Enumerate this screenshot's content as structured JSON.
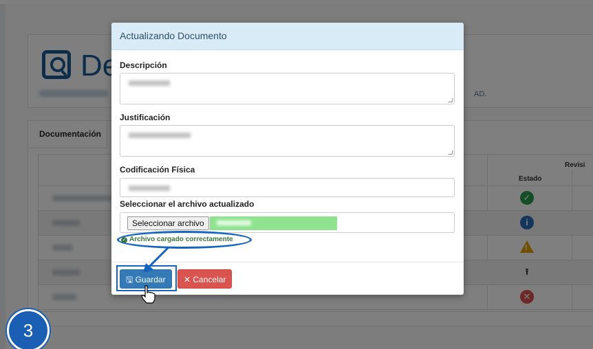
{
  "background": {
    "title": "De",
    "subtitle_tail": "AD.",
    "docs_tab": "Documentación",
    "table": {
      "group_header": "Revisi",
      "status_header": "Estado",
      "rows": [
        {
          "status": "check"
        },
        {
          "status": "info"
        },
        {
          "status": "warning"
        },
        {
          "status": "upload"
        },
        {
          "status": "error"
        }
      ]
    }
  },
  "modal": {
    "title": "Actualizando Documento",
    "fields": {
      "description_label": "Descripción",
      "justification_label": "Justificación",
      "physical_code_label": "Codificación Física",
      "file_label": "Seleccionar el archivo actualizado"
    },
    "file_button": "Seleccionar archivo",
    "success_message": "Archivo cargado correctamente",
    "save_button": "Guardar",
    "cancel_button": "Cancelar",
    "save_icon": "floppy-disk-icon",
    "cancel_icon": "x-icon"
  },
  "annotation": {
    "step_number": "3",
    "highlight_color": "#1564c0"
  },
  "colors": {
    "primary": "#337ab7",
    "danger": "#d9534f",
    "success": "#3c763d",
    "header_bg": "#d9ebf6",
    "file_selected": "#8fe38f"
  }
}
